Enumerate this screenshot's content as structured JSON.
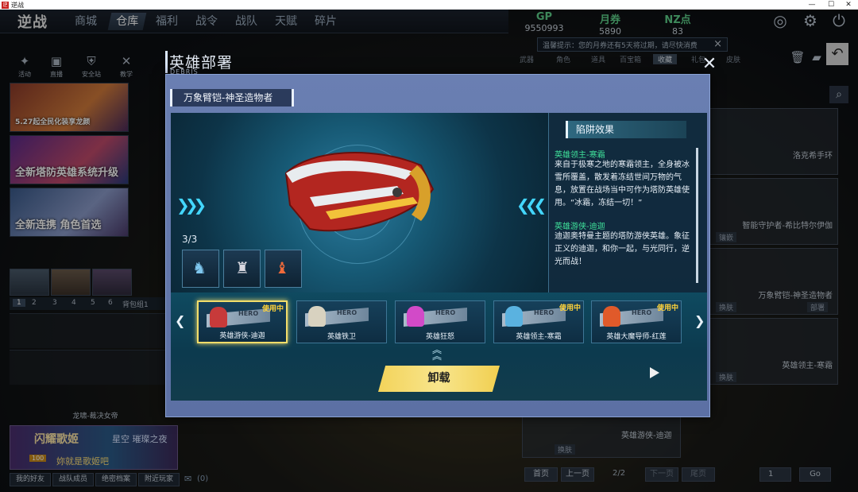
{
  "window": {
    "title": "逆战",
    "controls": [
      "—",
      "☐",
      "✕"
    ]
  },
  "game": {
    "logo": "逆战",
    "nav_tabs": [
      "商城",
      "仓库",
      "福利",
      "战令",
      "战队",
      "天赋",
      "碎片"
    ],
    "active_tab": "仓库",
    "currencies": [
      {
        "name": "GP",
        "value": "9550993"
      },
      {
        "name": "月券",
        "value": "5890"
      },
      {
        "name": "NZ点",
        "value": "83"
      }
    ],
    "notice": "温馨提示：您的月券还有5天将过期，请尽快消费",
    "left_icons": [
      "活动",
      "直播",
      "安全站",
      "教学"
    ],
    "promos": [
      "5.27起全民化装享龙颜",
      "全新塔防英雄系统升级",
      "全新连携 角色首选"
    ],
    "loadout": {
      "numbers": [
        "1",
        "2",
        "3",
        "4",
        "5",
        "6"
      ],
      "group": "背包组1"
    },
    "weapon_caption": "龙啸-裁决女帝",
    "event_banner": {
      "title": "闪耀歌姬",
      "subtitle": "星空 璀璨之夜",
      "level": "100",
      "text": "妳就是歌姬吧"
    },
    "bottom_buttons": [
      "我的好友",
      "战队成员",
      "绝密档案",
      "附近玩家"
    ],
    "mail_count": "(0)",
    "right_tabs": [
      "武器",
      "角色",
      "道具",
      "百宝箱",
      "收藏",
      "礼包",
      "皮肤"
    ],
    "right_cards": [
      {
        "name": "洛克希手环",
        "tag": ""
      },
      {
        "name": "智能守护者-希比特尔伊伽",
        "tag": "镶嵌"
      },
      {
        "name": "万象臂铠-神圣造物者",
        "tag": "换肤",
        "tag2": "部署"
      },
      {
        "name": "英雄领主-寒霜",
        "tag": "换肤"
      }
    ],
    "bg_bottom_card": {
      "name": "英雄游侠-迪迦",
      "tag": "换肤"
    },
    "pager": {
      "first": "首页",
      "prev": "上一页",
      "page": "2/2",
      "next": "下一页",
      "last": "尾页",
      "input": "1",
      "go": "Go"
    }
  },
  "modal": {
    "title": "英雄部署",
    "subtitle": "DEBRIS",
    "item_title": "万象臂铠-神圣造物者",
    "skin_count": "3/3",
    "trap_header": "陷阱效果",
    "traps": [
      {
        "name": "英雄领主-寒霜",
        "desc": "来自于极寒之地的寒霜领主，全身被冰雪所覆盖，散发着冻结世间万物的气息，放置在战场当中可作为塔防英雄使用。“冰霜，冻结一切！”"
      },
      {
        "name": "英雄游侠-迪迦",
        "desc": "迪迦奥特曼主题的塔防游侠英雄。象征正义的迪迦，和你一起，与光同行，逆光而战！"
      }
    ],
    "heroes": [
      {
        "name": "英雄游侠-迪迦",
        "in_use": "使用中",
        "selected": true
      },
      {
        "name": "英雄铁卫",
        "in_use": "",
        "selected": false
      },
      {
        "name": "英雄狂怒",
        "in_use": "",
        "selected": false
      },
      {
        "name": "英雄领主-寒霜",
        "in_use": "使用中",
        "selected": false
      },
      {
        "name": "英雄大魔导师-红莲",
        "in_use": "使用中",
        "selected": false
      }
    ],
    "hero_badge": "HERO",
    "unload_button": "卸载",
    "colors": {
      "accent_yellow": "#f3d35a",
      "trap_name_green": "#3fe09a",
      "chevron_cyan": "#43d7ff"
    }
  }
}
